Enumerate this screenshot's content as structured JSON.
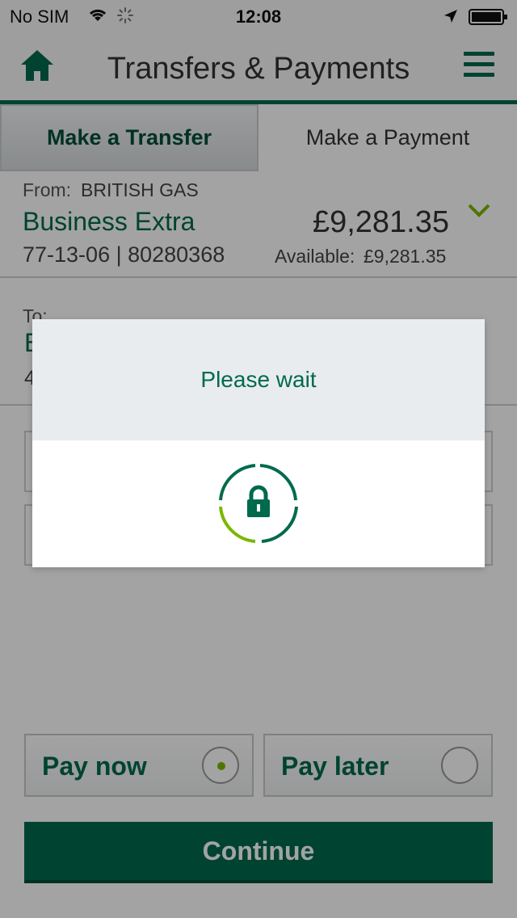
{
  "status_bar": {
    "carrier": "No SIM",
    "time": "12:08",
    "icons": [
      "wifi-icon",
      "activity-icon",
      "location-icon",
      "battery-icon"
    ]
  },
  "header": {
    "title": "Transfers & Payments",
    "icons": [
      "home-icon",
      "menu-icon"
    ]
  },
  "tabs": [
    {
      "label": "Make a Transfer",
      "selected": true
    },
    {
      "label": "Make a Payment",
      "selected": false
    }
  ],
  "from": {
    "label": "From:",
    "payee": "BRITISH GAS",
    "account_name": "Business Extra",
    "account_number": "77-13-06 | 80280368",
    "balance": "£9,281.35",
    "available_label": "Available:",
    "available_value": "£9,281.35"
  },
  "to": {
    "label": "To:",
    "account_name_visible": "B",
    "account_number_visible": "4"
  },
  "timing": {
    "pay_now": {
      "label": "Pay now",
      "selected": true
    },
    "pay_later": {
      "label": "Pay later",
      "selected": false
    }
  },
  "continue_label": "Continue",
  "dialog": {
    "title": "Please wait",
    "icon": "lock-spinner-icon"
  },
  "colors": {
    "brand_green": "#006a4d",
    "accent_lime": "#7ab800"
  }
}
